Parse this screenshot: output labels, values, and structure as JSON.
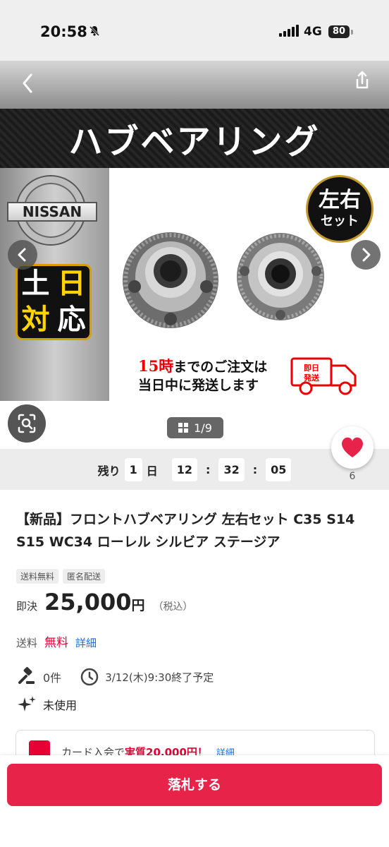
{
  "status_bar": {
    "time": "20:58",
    "network": "4G",
    "battery": "80",
    "icons": [
      "bell-slash-icon",
      "signal-icon",
      "battery-icon"
    ]
  },
  "nav": {
    "icons": [
      "chevron-left-icon",
      "share-icon"
    ]
  },
  "image": {
    "banner_text": "ハブベアリング",
    "brand_logo": "NISSAN",
    "fitment_chars": [
      "土",
      "日",
      "対",
      "応"
    ],
    "set_badge_line1": "左右",
    "set_badge_line2": "セット",
    "shipping_note_highlight": "15時",
    "shipping_note_rest": "までのご注文は",
    "shipping_note_line2": "当日中に発送します",
    "truck_label_line1": "即日",
    "truck_label_line2": "発送",
    "counter": "1/9"
  },
  "timer": {
    "prefix": "残り",
    "days": "1",
    "day_unit": "日",
    "hours": "12",
    "minutes": "32",
    "seconds": "05",
    "separator": ":"
  },
  "likes": {
    "count": "6"
  },
  "listing": {
    "title": "【新品】フロントハブベアリング 左右セット C35 S14 S15 WC34 ローレル シルビア ステージア",
    "tags": [
      "送料無料",
      "匿名配送"
    ],
    "price_label": "即決",
    "price": "25,000",
    "currency": "円",
    "tax_note": "（税込）",
    "shipping_label": "送料",
    "shipping_value": "無料",
    "shipping_link": "詳細",
    "bids": "0件",
    "end_time": "3/12(木)9:30終了予定",
    "condition": "未使用"
  },
  "promo": {
    "text_prefix": "カード入会で",
    "text_highlight": "実質20,000円！",
    "link": "詳細"
  },
  "action": {
    "bid_button": "落札する"
  },
  "colors": {
    "accent_red": "#e8234a",
    "price_free_red": "#e60033",
    "link_blue": "#1a6ed8"
  }
}
